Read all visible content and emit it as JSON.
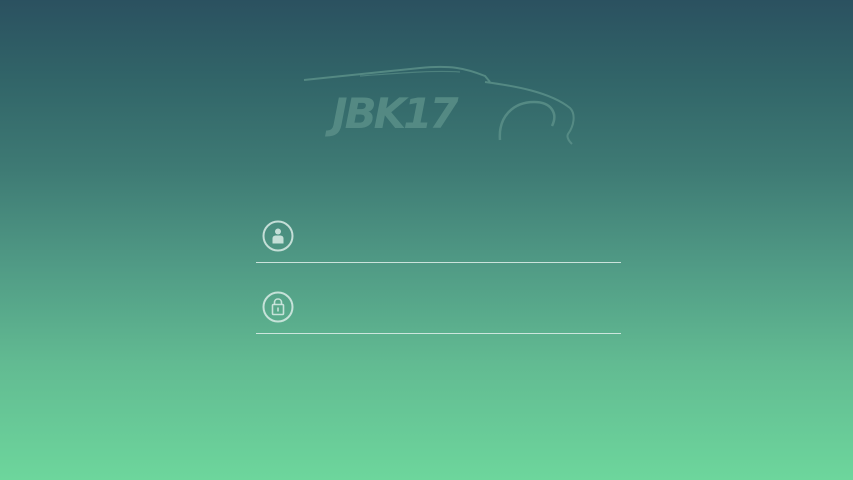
{
  "brand": {
    "logo_text": "JBK17",
    "logo_icon": "car-silhouette"
  },
  "login": {
    "username": {
      "icon": "user-icon",
      "value": "",
      "placeholder": ""
    },
    "password": {
      "icon": "lock-icon",
      "value": "",
      "placeholder": ""
    }
  },
  "colors": {
    "gradient_top": "#2b5160",
    "gradient_bottom": "#6dd69c",
    "field_line": "#e1f0eb",
    "logo": "#5a8f88"
  }
}
